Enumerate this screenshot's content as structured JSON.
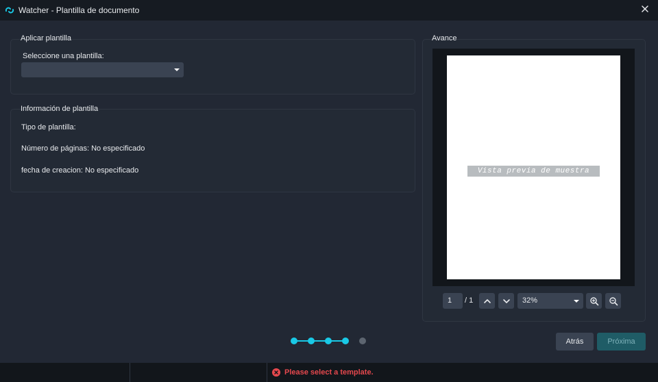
{
  "window": {
    "title": "Watcher - Plantilla de documento"
  },
  "apply_template": {
    "section_title": "Aplicar plantilla",
    "select_label": "Seleccione una plantilla:",
    "select_value": ""
  },
  "template_info": {
    "section_title": "Información de plantilla",
    "type_line": "Tipo de plantilla:",
    "pages_line": "Número de páginas: No especificado",
    "date_line": "fecha de creacion: No especificado"
  },
  "preview": {
    "section_title": "Avance",
    "watermark": "Vista previa de muestra",
    "page_current": "1",
    "page_total": "/ 1",
    "zoom": "32%"
  },
  "stepper": {
    "total_steps": 5,
    "completed_steps": 4
  },
  "buttons": {
    "back": "Atrás",
    "next": "Próxima"
  },
  "status": {
    "message": "Please select a template."
  },
  "colors": {
    "accent": "#19c9e6",
    "error": "#e5484d",
    "background": "#222834"
  }
}
